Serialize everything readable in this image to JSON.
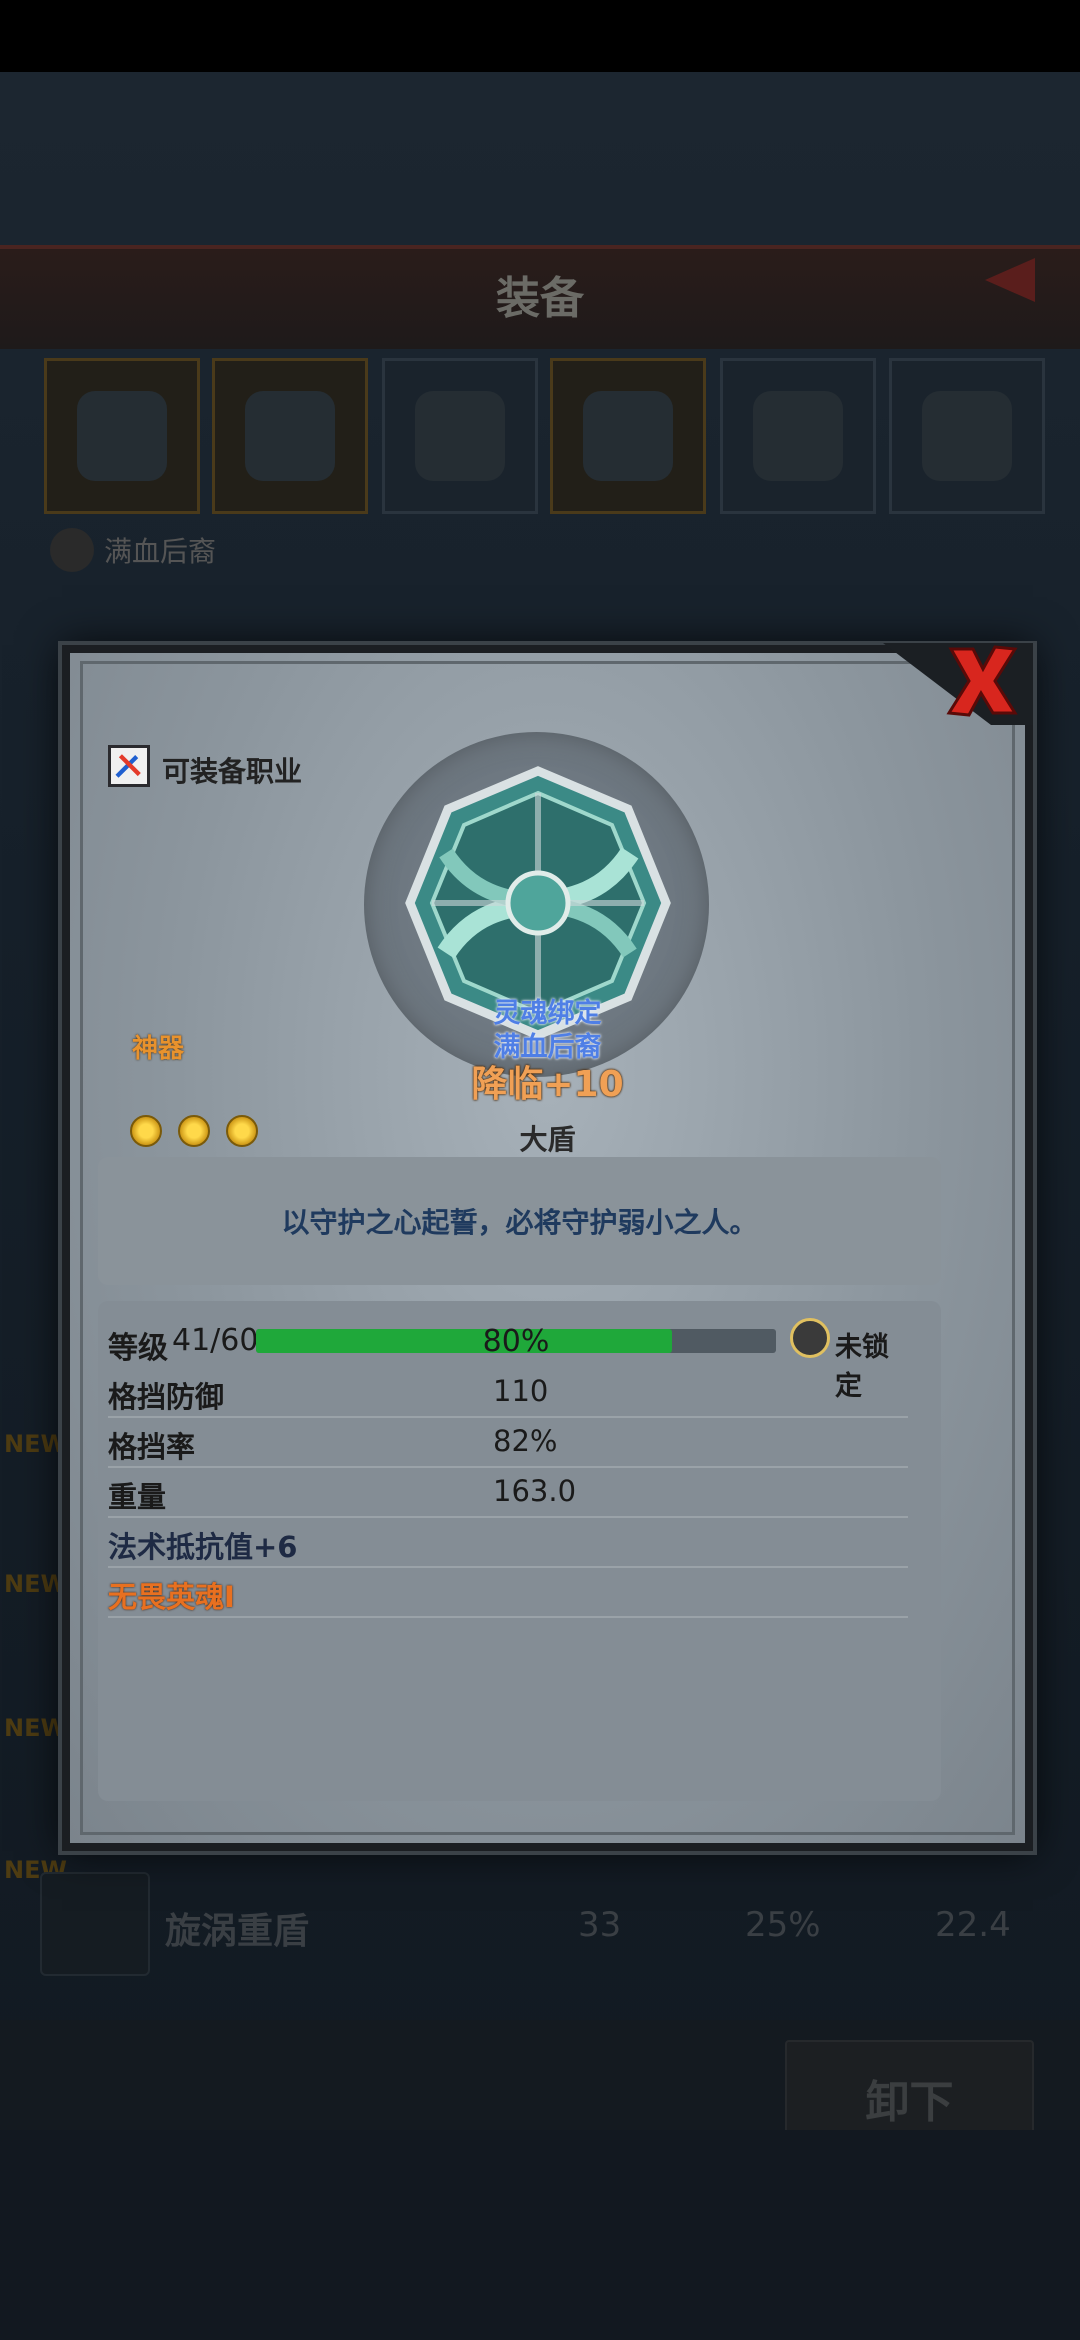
{
  "background": {
    "screen_title": "装备",
    "owner_name": "满血后裔",
    "new_badge": "NEW",
    "list_row": {
      "name": "旋涡重盾",
      "block": "33",
      "rate": "25%",
      "weight": "22.4"
    },
    "unequip_label": "卸下"
  },
  "modal": {
    "job_label": "可装备职业",
    "rarity": "神器",
    "stars": 3,
    "soul_bound_label": "灵魂绑定",
    "bound_owner": "满血后裔",
    "item_name": "降临+10",
    "item_type": "大盾",
    "description": "以守护之心起誓，必将守护弱小之人。",
    "level": {
      "label": "等级",
      "value": "41/60",
      "progress_percent": 80,
      "progress_text": "80%",
      "lock_status": "未锁定"
    },
    "stats": [
      {
        "label": "格挡防御",
        "value": "110",
        "style": "normal"
      },
      {
        "label": "格挡率",
        "value": "82%",
        "style": "normal"
      },
      {
        "label": "重量",
        "value": "163.0",
        "style": "normal"
      },
      {
        "label": "法术抵抗值+6",
        "value": "",
        "style": "blue"
      },
      {
        "label": "无畏英魂I",
        "value": "",
        "style": "orange"
      }
    ]
  },
  "colors": {
    "rarity": "#e8922d",
    "item_name": "#f0a055",
    "soul_bound": "#4f7fe6",
    "progress_fill": "#1fa83a",
    "close_x": "#d8261e"
  }
}
